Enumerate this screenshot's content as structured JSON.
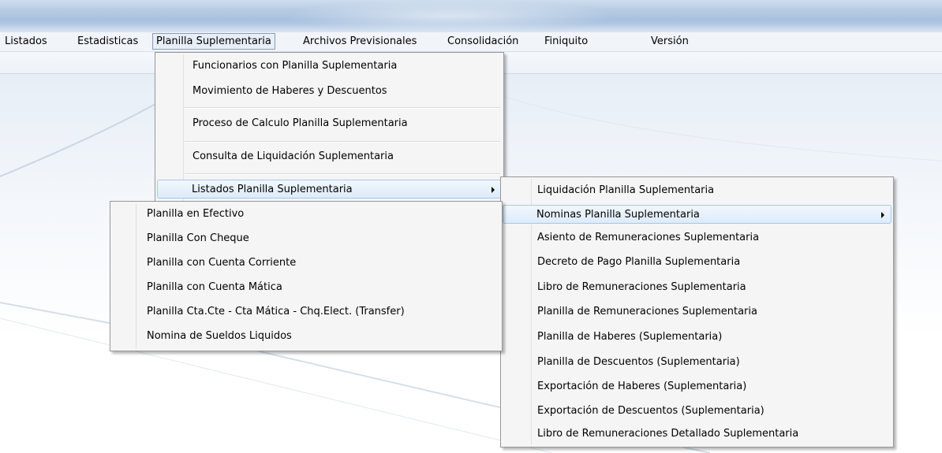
{
  "menubar": {
    "items": [
      "Listados",
      "Estadisticas",
      "Planilla Suplementaria",
      "Archivos Previsionales",
      "Consolidación",
      "Finiquito",
      "Versión"
    ]
  },
  "menu_planilla": {
    "items": [
      "Funcionarios con Planilla Suplementaria",
      "Movimiento de Haberes y Descuentos",
      "Proceso de Calculo Planilla Suplementaria",
      "Consulta de Liquidación Suplementaria",
      "Listados Planilla Suplementaria"
    ]
  },
  "menu_listados": {
    "items": [
      "Liquidación Planilla Suplementaria",
      "Nominas Planilla Suplementaria",
      "Asiento de Remuneraciones Suplementaria",
      "Decreto de Pago Planilla Suplementaria",
      "Libro de Remuneraciones Suplementaria",
      "Planilla de Remuneraciones Suplementaria",
      "Planilla de Haberes (Suplementaria)",
      "Planilla de Descuentos (Suplementaria)",
      "Exportación de Haberes (Suplementaria)",
      "Exportación de Descuentos (Suplementaria)",
      "Libro de Remuneraciones Detallado Suplementaria"
    ]
  },
  "menu_nominas": {
    "items": [
      "Planilla en Efectivo",
      "Planilla Con Cheque",
      "Planilla con Cuenta Corriente",
      "Planilla con Cuenta Mática",
      "Planilla Cta.Cte - Cta Mática - Chq.Elect. (Transfer)",
      "Nomina de Sueldos Liquidos"
    ]
  },
  "icons": {
    "submenu_arrow": "chevron-right-icon"
  }
}
